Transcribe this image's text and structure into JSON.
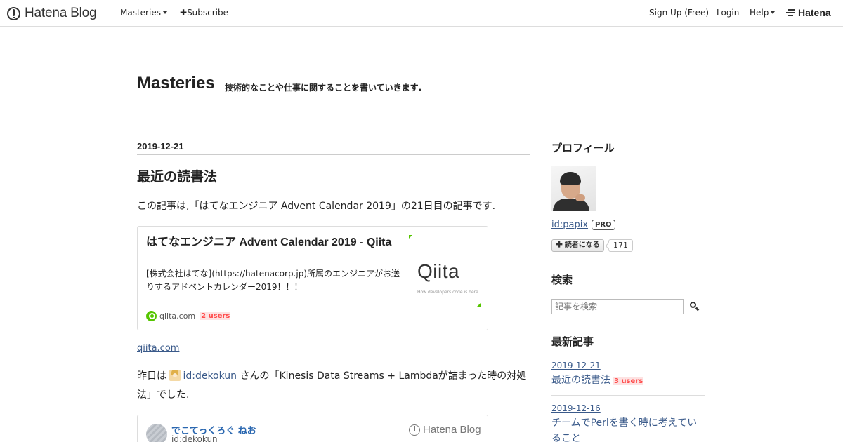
{
  "topbar": {
    "logo_text": "Hatena Blog",
    "masteries_label": "Masteries",
    "subscribe_label": "Subscribe",
    "signup_label": "Sign Up (Free)",
    "login_label": "Login",
    "help_label": "Help",
    "hatena_label": "Hatena"
  },
  "header": {
    "title": "Masteries",
    "description": "技術的なことや仕事に関することを書いていきます."
  },
  "entry": {
    "date": "2019-12-21",
    "title": "最近の読書法",
    "intro": "この記事は,「はてなエンジニア Advent Calendar 2019」の21日目の記事です.",
    "card1": {
      "title": "はてなエンジニア Advent Calendar 2019 - Qiita",
      "description": "[株式会社はてな](https://hatenacorp.jp)所属のエンジニアがお送りするアドベントカレンダー2019！！！",
      "thumb_logo": "Qiita",
      "thumb_tagline": "How developers code is here.",
      "domain": "qiita.com",
      "users": "2 users"
    },
    "source_link": "qiita.com",
    "para2_prefix": "昨日は",
    "para2_user": "id:dekokun",
    "para2_suffix": " さんの「Kinesis Data Streams + Lambdaが詰まった時の対処法」でした.",
    "card2": {
      "name": "でこてっくろぐ ねお",
      "id": "id:dekokun",
      "brand": "Hatena Blog"
    }
  },
  "sidebar": {
    "profile_heading": "プロフィール",
    "profile_id": "id:papix",
    "pro_badge": "PRO",
    "subscribe_button": "読者になる",
    "subscriber_count": "171",
    "search_heading": "検索",
    "search_placeholder": "記事を検索",
    "recent_heading": "最新記事",
    "recent": [
      {
        "date": "2019-12-21",
        "title": "最近の読書法",
        "users": "3 users"
      },
      {
        "date": "2019-12-16",
        "title": "チームでPerlを書く時に考えていること"
      }
    ]
  },
  "colors": {
    "link": "#3a5a8a",
    "qiita_green": "#55c500",
    "users_red": "#ff4b4b"
  }
}
